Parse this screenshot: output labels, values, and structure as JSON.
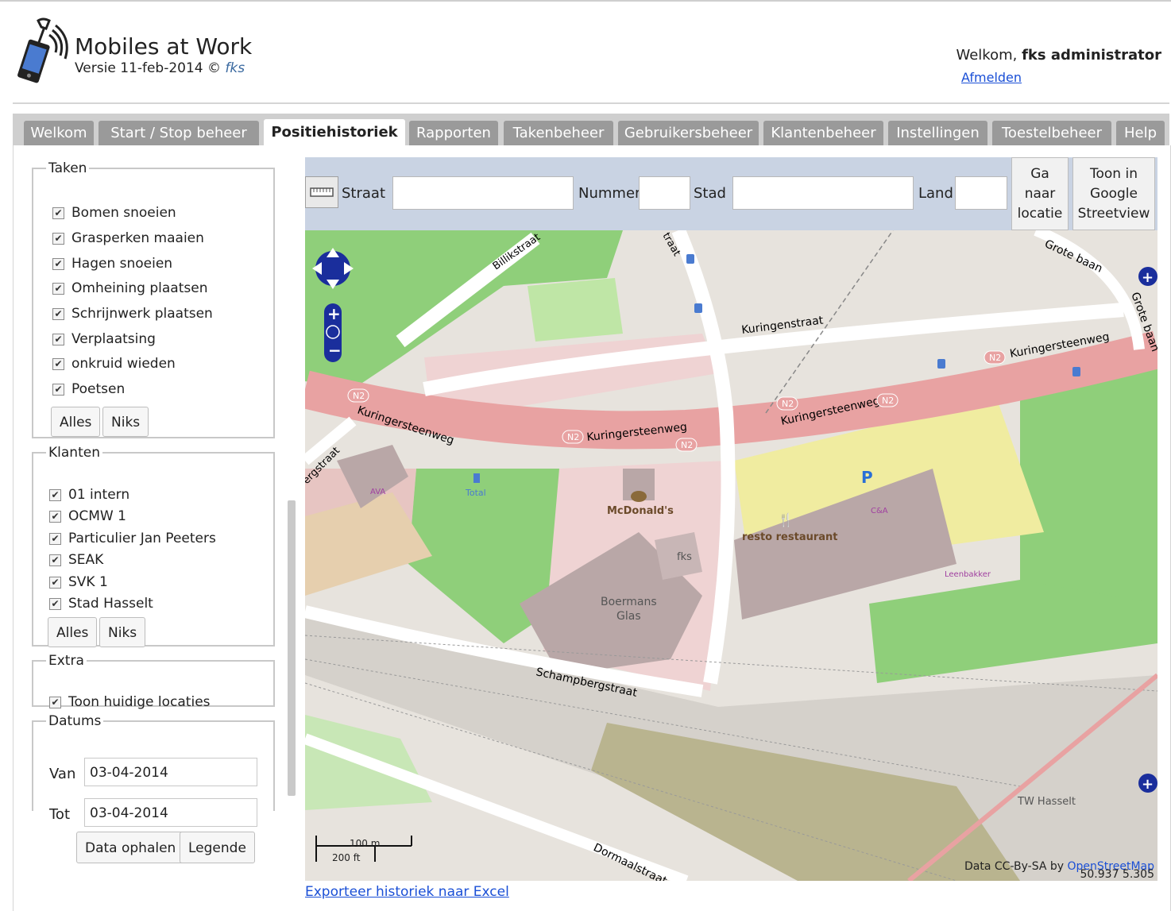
{
  "app": {
    "title": "Mobiles at Work",
    "version_prefix": "Versie 11-feb-2014 ©",
    "version_owner": "fks"
  },
  "user": {
    "welcome_prefix": "Welkom,",
    "name": "fks administrator",
    "logout": "Afmelden"
  },
  "tabs": [
    {
      "label": "Welkom"
    },
    {
      "label": "Start / Stop beheer"
    },
    {
      "label": "Positiehistoriek",
      "active": true
    },
    {
      "label": "Rapporten"
    },
    {
      "label": "Takenbeheer"
    },
    {
      "label": "Gebruikersbeheer"
    },
    {
      "label": "Klantenbeheer"
    },
    {
      "label": "Instellingen"
    },
    {
      "label": "Toestelbeheer"
    },
    {
      "label": "Help"
    }
  ],
  "taken": {
    "legend": "Taken",
    "items": [
      {
        "label": "Bomen snoeien",
        "checked": true
      },
      {
        "label": "Grasperken maaien",
        "checked": true
      },
      {
        "label": "Hagen snoeien",
        "checked": true
      },
      {
        "label": "Omheining plaatsen",
        "checked": true
      },
      {
        "label": "Schrijnwerk plaatsen",
        "checked": true
      },
      {
        "label": "Verplaatsing",
        "checked": true
      },
      {
        "label": "onkruid wieden",
        "checked": true
      },
      {
        "label": "Poetsen",
        "checked": true
      }
    ],
    "all_label": "Alles",
    "none_label": "Niks"
  },
  "klanten": {
    "legend": "Klanten",
    "items": [
      {
        "label": "01 intern",
        "checked": true
      },
      {
        "label": "OCMW 1",
        "checked": true
      },
      {
        "label": "Particulier Jan Peeters",
        "checked": true
      },
      {
        "label": "SEAK",
        "checked": true
      },
      {
        "label": "SVK 1",
        "checked": true
      },
      {
        "label": "Stad Hasselt",
        "checked": true
      }
    ],
    "all_label": "Alles",
    "none_label": "Niks"
  },
  "extra": {
    "legend": "Extra",
    "items": [
      {
        "label": "Toon huidige locaties",
        "checked": true
      }
    ]
  },
  "datums": {
    "legend": "Datums",
    "van_label": "Van",
    "van_value": "03-04-2014",
    "tot_label": "Tot",
    "tot_value": "03-04-2014"
  },
  "actions": {
    "fetch": "Data ophalen",
    "legend": "Legende"
  },
  "search": {
    "straat_label": "Straat",
    "nummer_label": "Nummer",
    "stad_label": "Stad",
    "land_label": "Land",
    "straat_value": "",
    "nummer_value": "",
    "stad_value": "",
    "land_value": "",
    "goto_line1": "Ga",
    "goto_line2": "naar",
    "goto_line3": "locatie",
    "streetview_line1": "Toon in",
    "streetview_line2": "Google",
    "streetview_line3": "Streetview"
  },
  "map": {
    "streets": {
      "billikstraat": "Billikstraat",
      "kuringenstraat": "Kuringenstraat",
      "kuringersteenweg": "Kuringersteenweg",
      "grote_baan": "Grote baan",
      "schampbergstraat": "Schampbergstraat",
      "dormaalstraat": "Dormaalstraat",
      "bergstraat": "ergstraat",
      "straat_top": "traat"
    },
    "route_badge": "N2",
    "pois": {
      "mcdonalds": "McDonald's",
      "resto": "resto restaurant",
      "fks": "fks",
      "boermans1": "Boermans",
      "boermans2": "Glas",
      "ava": "AVA",
      "total": "Total",
      "csa": "C&A",
      "leenbakker": "Leenbakker",
      "tw_hasselt": "TW Hasselt",
      "parking": "P"
    },
    "scale_m": "100 m",
    "scale_ft": "200 ft",
    "attribution_prefix": "Data CC-By-SA by",
    "attribution_link": "OpenStreetMap",
    "coords": "50.937 5.305"
  },
  "export": "Exporteer historiek naar Excel",
  "colors": {
    "tab_bg": "#9a9a9a",
    "road_main": "#e8a2a2",
    "park": "#8fcf7a",
    "link": "#1a4fd6"
  }
}
